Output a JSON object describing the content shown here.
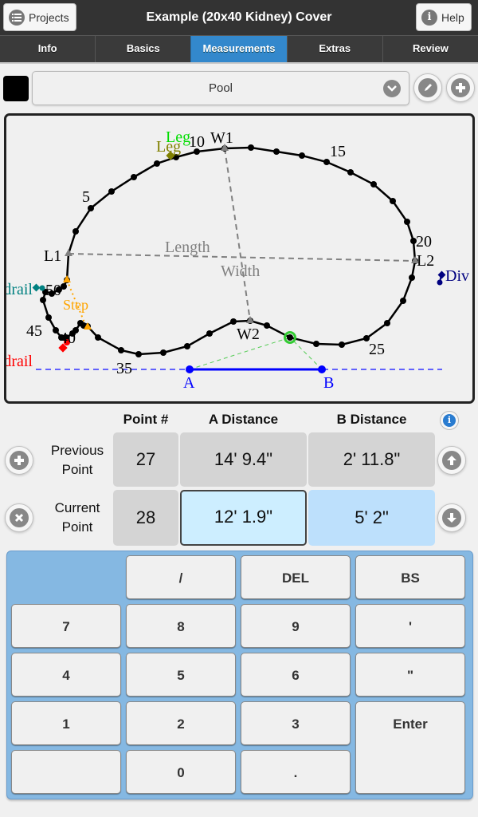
{
  "header": {
    "title": "Example (20x40 Kidney) Cover",
    "projects_label": "Projects",
    "help_label": "Help"
  },
  "tabs": [
    {
      "label": "Info",
      "active": false
    },
    {
      "label": "Basics",
      "active": false
    },
    {
      "label": "Measurements",
      "active": true
    },
    {
      "label": "Extras",
      "active": false
    },
    {
      "label": "Review",
      "active": false
    }
  ],
  "shape_select": {
    "swatch_color": "#000000",
    "selected": "Pool"
  },
  "diagram": {
    "outline_color": "#000000",
    "point_labels": [
      "5",
      "10",
      "15",
      "20",
      "25",
      "35",
      "40",
      "45",
      "50"
    ],
    "reference_labels": {
      "w1": "W1",
      "w2": "W2",
      "l1": "L1",
      "l2": "L2",
      "length": "Length",
      "width": "Width",
      "a": "A",
      "b": "B"
    },
    "features": [
      {
        "label": "Leg",
        "color": "#00dd00"
      },
      {
        "label": "Leg",
        "color": "#808000"
      },
      {
        "label": "Step",
        "color": "#ffa500"
      },
      {
        "label": "Handrail",
        "color": "#ff0000"
      },
      {
        "label": "Handrail",
        "color": "#008080"
      },
      {
        "label": "Div",
        "color": "#000080"
      }
    ],
    "colors": {
      "reference": "#808080",
      "baseline": "#0000ff",
      "current_point": "#33cc33"
    }
  },
  "measurements": {
    "headers": {
      "point": "Point #",
      "a": "A Distance",
      "b": "B Distance"
    },
    "previous": {
      "label": "Previous Point",
      "point": "27",
      "a": "14' 9.4\"",
      "b": "2' 11.8\""
    },
    "current": {
      "label": "Current Point",
      "point": "28",
      "a": "12' 1.9\"",
      "b": "5' 2\""
    }
  },
  "keypad": {
    "keys": [
      "/",
      "DEL",
      "BS",
      "7",
      "8",
      "9",
      "'",
      "4",
      "5",
      "6",
      "\"",
      "1",
      "2",
      "3",
      "Enter",
      "",
      "0",
      "."
    ]
  }
}
